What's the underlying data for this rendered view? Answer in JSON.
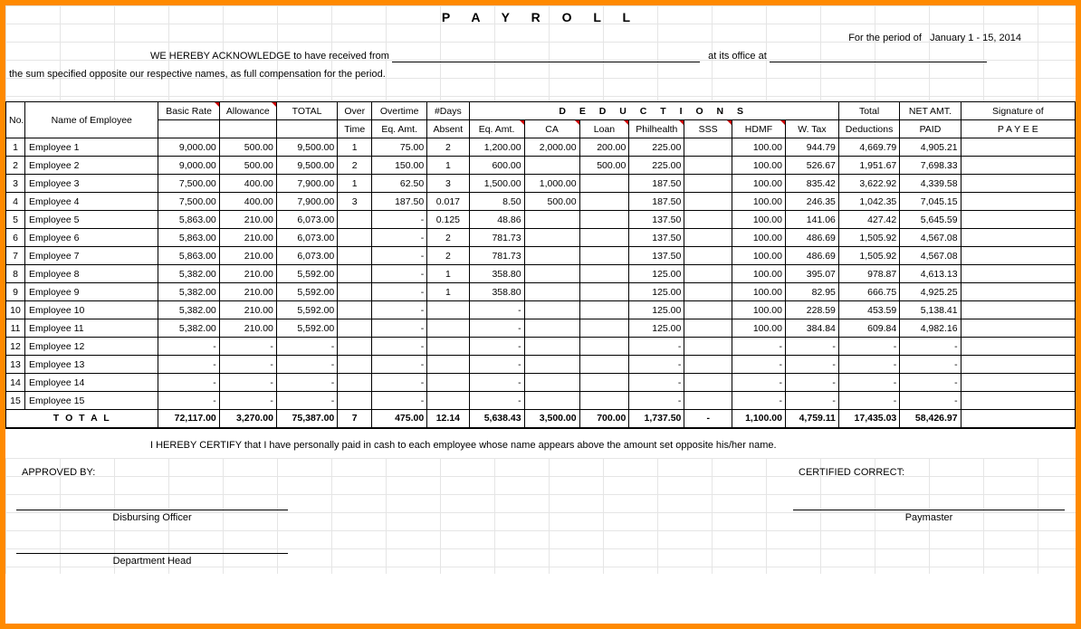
{
  "title": "P A Y R O L L",
  "period_prefix": "For the period of",
  "period_value": "January 1 - 15,  2014",
  "ack_prefix": "WE HEREBY ACKNOWLEDGE to have received from",
  "ack_mid": "at its office at",
  "sum_line": "the sum specified opposite our respective names, as full compensation for the period.",
  "headers": {
    "no": "No.",
    "name": "Name of Employee",
    "basic": "Basic Rate",
    "allow": "Allowance",
    "total": "TOTAL",
    "over": "Over",
    "time": "Time",
    "overtime": "Overtime",
    "eqamt": "Eq. Amt.",
    "days": "#Days",
    "absent": "Absent",
    "deductions": "D E D U C T I O N S",
    "ded_eq": "Eq. Amt.",
    "ca": "CA",
    "loan": "Loan",
    "philhealth": "Philhealth",
    "sss": "SSS",
    "hdmf": "HDMF",
    "wtax": "W. Tax",
    "totded": "Total",
    "totded2": "Deductions",
    "net": "NET AMT.",
    "paid": "PAID",
    "sig": "Signature of",
    "payee": "P A Y E E"
  },
  "rows": [
    {
      "no": "1",
      "name": "Employee 1",
      "basic": "9,000.00",
      "allow": "500.00",
      "total": "9,500.00",
      "ot": "1",
      "ot_eq": "75.00",
      "days": "2",
      "d_eq": "1,200.00",
      "ca": "2,000.00",
      "loan": "200.00",
      "ph": "225.00",
      "sss": "",
      "hdmf": "100.00",
      "wtax": "944.79",
      "totded": "4,669.79",
      "net": "4,905.21"
    },
    {
      "no": "2",
      "name": "Employee 2",
      "basic": "9,000.00",
      "allow": "500.00",
      "total": "9,500.00",
      "ot": "2",
      "ot_eq": "150.00",
      "days": "1",
      "d_eq": "600.00",
      "ca": "",
      "loan": "500.00",
      "ph": "225.00",
      "sss": "",
      "hdmf": "100.00",
      "wtax": "526.67",
      "totded": "1,951.67",
      "net": "7,698.33"
    },
    {
      "no": "3",
      "name": "Employee 3",
      "basic": "7,500.00",
      "allow": "400.00",
      "total": "7,900.00",
      "ot": "1",
      "ot_eq": "62.50",
      "days": "3",
      "d_eq": "1,500.00",
      "ca": "1,000.00",
      "loan": "",
      "ph": "187.50",
      "sss": "",
      "hdmf": "100.00",
      "wtax": "835.42",
      "totded": "3,622.92",
      "net": "4,339.58"
    },
    {
      "no": "4",
      "name": "Employee 4",
      "basic": "7,500.00",
      "allow": "400.00",
      "total": "7,900.00",
      "ot": "3",
      "ot_eq": "187.50",
      "days": "0.017",
      "d_eq": "8.50",
      "ca": "500.00",
      "loan": "",
      "ph": "187.50",
      "sss": "",
      "hdmf": "100.00",
      "wtax": "246.35",
      "totded": "1,042.35",
      "net": "7,045.15"
    },
    {
      "no": "5",
      "name": "Employee 5",
      "basic": "5,863.00",
      "allow": "210.00",
      "total": "6,073.00",
      "ot": "",
      "ot_eq": "-",
      "days": "0.125",
      "d_eq": "48.86",
      "ca": "",
      "loan": "",
      "ph": "137.50",
      "sss": "",
      "hdmf": "100.00",
      "wtax": "141.06",
      "totded": "427.42",
      "net": "5,645.59"
    },
    {
      "no": "6",
      "name": "Employee 6",
      "basic": "5,863.00",
      "allow": "210.00",
      "total": "6,073.00",
      "ot": "",
      "ot_eq": "-",
      "days": "2",
      "d_eq": "781.73",
      "ca": "",
      "loan": "",
      "ph": "137.50",
      "sss": "",
      "hdmf": "100.00",
      "wtax": "486.69",
      "totded": "1,505.92",
      "net": "4,567.08"
    },
    {
      "no": "7",
      "name": "Employee 7",
      "basic": "5,863.00",
      "allow": "210.00",
      "total": "6,073.00",
      "ot": "",
      "ot_eq": "-",
      "days": "2",
      "d_eq": "781.73",
      "ca": "",
      "loan": "",
      "ph": "137.50",
      "sss": "",
      "hdmf": "100.00",
      "wtax": "486.69",
      "totded": "1,505.92",
      "net": "4,567.08"
    },
    {
      "no": "8",
      "name": "Employee 8",
      "basic": "5,382.00",
      "allow": "210.00",
      "total": "5,592.00",
      "ot": "",
      "ot_eq": "-",
      "days": "1",
      "d_eq": "358.80",
      "ca": "",
      "loan": "",
      "ph": "125.00",
      "sss": "",
      "hdmf": "100.00",
      "wtax": "395.07",
      "totded": "978.87",
      "net": "4,613.13"
    },
    {
      "no": "9",
      "name": "Employee 9",
      "basic": "5,382.00",
      "allow": "210.00",
      "total": "5,592.00",
      "ot": "",
      "ot_eq": "-",
      "days": "1",
      "d_eq": "358.80",
      "ca": "",
      "loan": "",
      "ph": "125.00",
      "sss": "",
      "hdmf": "100.00",
      "wtax": "82.95",
      "totded": "666.75",
      "net": "4,925.25"
    },
    {
      "no": "10",
      "name": "Employee 10",
      "basic": "5,382.00",
      "allow": "210.00",
      "total": "5,592.00",
      "ot": "",
      "ot_eq": "-",
      "days": "",
      "d_eq": "-",
      "ca": "",
      "loan": "",
      "ph": "125.00",
      "sss": "",
      "hdmf": "100.00",
      "wtax": "228.59",
      "totded": "453.59",
      "net": "5,138.41"
    },
    {
      "no": "11",
      "name": "Employee 11",
      "basic": "5,382.00",
      "allow": "210.00",
      "total": "5,592.00",
      "ot": "",
      "ot_eq": "-",
      "days": "",
      "d_eq": "-",
      "ca": "",
      "loan": "",
      "ph": "125.00",
      "sss": "",
      "hdmf": "100.00",
      "wtax": "384.84",
      "totded": "609.84",
      "net": "4,982.16"
    },
    {
      "no": "12",
      "name": "Employee 12",
      "basic": "-",
      "allow": "-",
      "total": "-",
      "ot": "",
      "ot_eq": "-",
      "days": "",
      "d_eq": "-",
      "ca": "",
      "loan": "",
      "ph": "-",
      "sss": "",
      "hdmf": "-",
      "wtax": "-",
      "totded": "-",
      "net": "-"
    },
    {
      "no": "13",
      "name": "Employee 13",
      "basic": "-",
      "allow": "-",
      "total": "-",
      "ot": "",
      "ot_eq": "-",
      "days": "",
      "d_eq": "-",
      "ca": "",
      "loan": "",
      "ph": "-",
      "sss": "",
      "hdmf": "-",
      "wtax": "-",
      "totded": "-",
      "net": "-"
    },
    {
      "no": "14",
      "name": "Employee 14",
      "basic": "-",
      "allow": "-",
      "total": "-",
      "ot": "",
      "ot_eq": "-",
      "days": "",
      "d_eq": "-",
      "ca": "",
      "loan": "",
      "ph": "-",
      "sss": "",
      "hdmf": "-",
      "wtax": "-",
      "totded": "-",
      "net": "-"
    },
    {
      "no": "15",
      "name": "Employee 15",
      "basic": "-",
      "allow": "-",
      "total": "-",
      "ot": "",
      "ot_eq": "-",
      "days": "",
      "d_eq": "-",
      "ca": "",
      "loan": "",
      "ph": "-",
      "sss": "",
      "hdmf": "-",
      "wtax": "-",
      "totded": "-",
      "net": "-"
    }
  ],
  "totals": {
    "label": "T O T A L",
    "basic": "72,117.00",
    "allow": "3,270.00",
    "total": "75,387.00",
    "ot": "7",
    "ot_eq": "475.00",
    "days": "12.14",
    "d_eq": "5,638.43",
    "ca": "3,500.00",
    "loan": "700.00",
    "ph": "1,737.50",
    "sss": "-",
    "hdmf": "1,100.00",
    "wtax": "4,759.11",
    "totded": "17,435.03",
    "net": "58,426.97"
  },
  "certify": "I HEREBY CERTIFY  that I have personally paid in cash to each employee whose name appears above the amount set opposite his/her name.",
  "approved_by": "APPROVED BY:",
  "certified_correct": "CERTIFIED CORRECT:",
  "disbursing": "Disbursing Officer",
  "paymaster": "Paymaster",
  "dept_head": "Department Head"
}
